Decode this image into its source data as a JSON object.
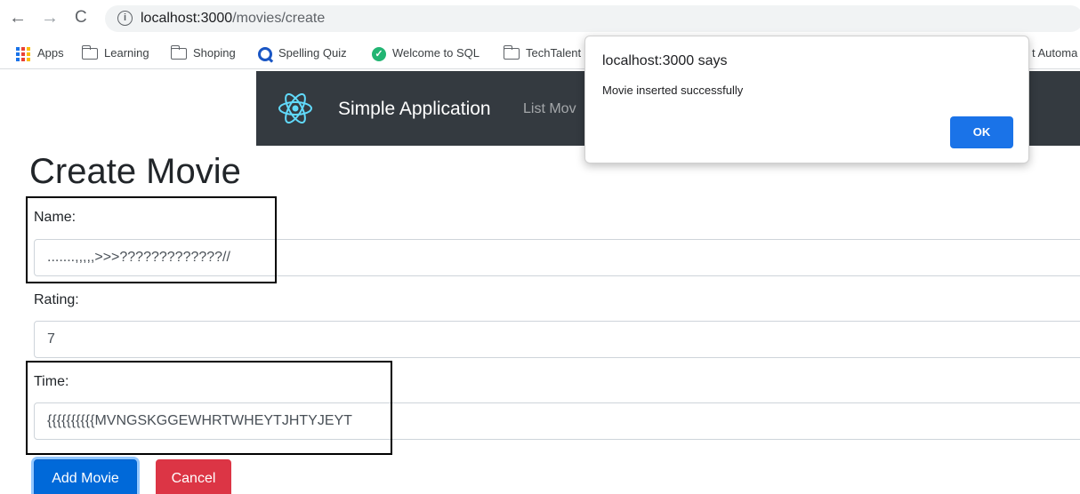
{
  "browser": {
    "url_host": "localhost:3000",
    "url_path": "/movies/create",
    "bookmarks": [
      {
        "label": "Apps",
        "icon": "apps-grid-icon"
      },
      {
        "label": "Learning",
        "icon": "folder-icon"
      },
      {
        "label": "Shoping",
        "icon": "folder-icon"
      },
      {
        "label": "Spelling Quiz",
        "icon": "q-logo-icon"
      },
      {
        "label": "Welcome to SQL",
        "icon": "sql-logo-icon"
      },
      {
        "label": "TechTalent",
        "icon": "folder-icon"
      },
      {
        "label": "t Automa",
        "icon": "none"
      }
    ]
  },
  "navbar": {
    "brand": "Simple Application",
    "link": "List Mov",
    "logo_icon": "react-atom-icon",
    "background": "#343a40"
  },
  "form": {
    "title": "Create Movie",
    "name_label": "Name:",
    "name_value": ".......,,,,,>>>?????????????//",
    "rating_label": "Rating:",
    "rating_value": "7",
    "time_label": "Time:",
    "time_value": "{{{{{{{{{{MVNGSKGGEWHRTWHEYTJHTYJEYT",
    "submit_label": "Add Movie",
    "cancel_label": "Cancel",
    "primary_color": "#0069d9",
    "danger_color": "#dc3545"
  },
  "dialog": {
    "title": "localhost:3000 says",
    "message": "Movie inserted successfully",
    "ok_label": "OK",
    "ok_color": "#1a73e8"
  }
}
